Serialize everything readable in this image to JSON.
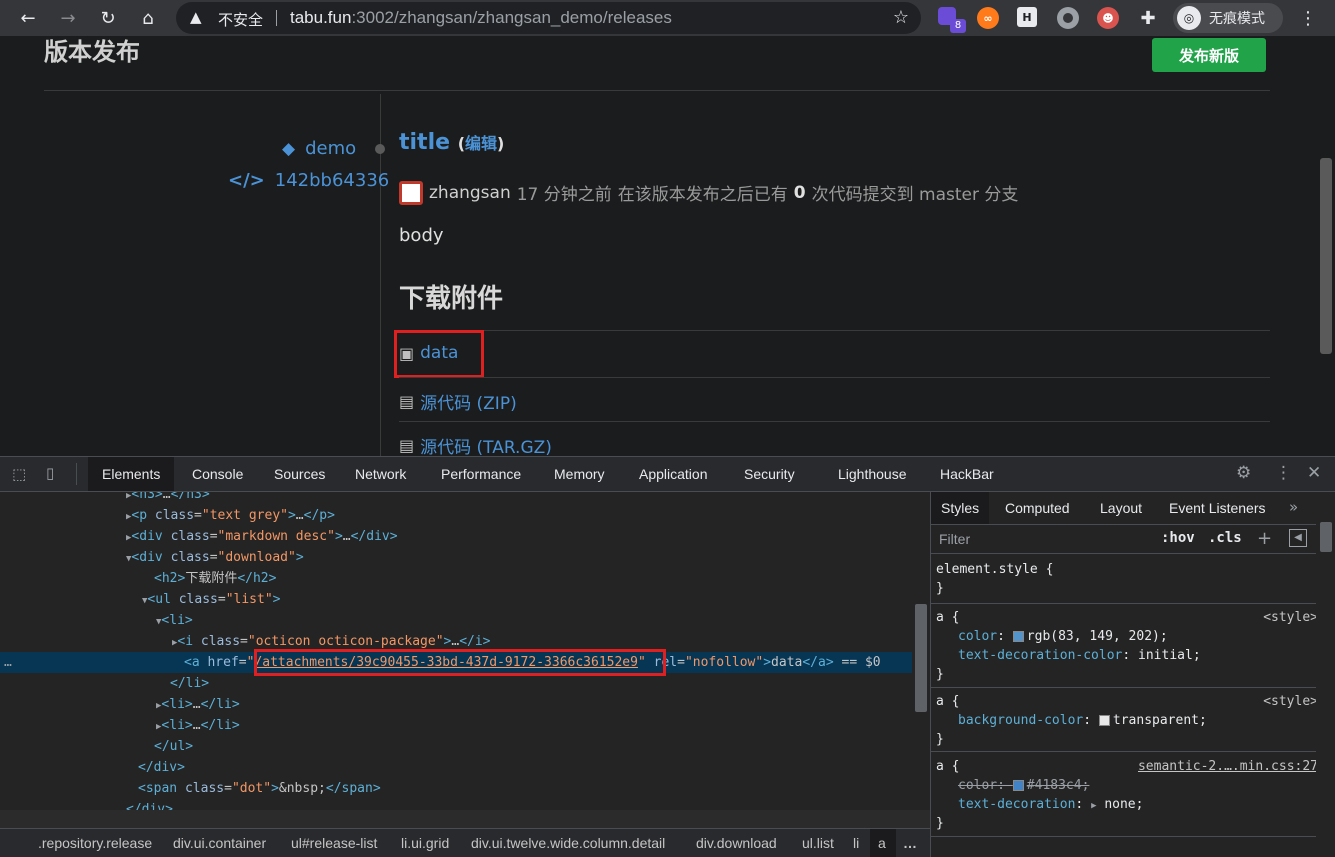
{
  "browser": {
    "insecure_label": "不安全",
    "url_host": "tabu.fun",
    "url_rest": ":3002/zhangsan/zhangsan_demo/releases",
    "incognito_label": "无痕模式",
    "ext_badge": "8"
  },
  "page": {
    "title": "版本发布",
    "publish_button": "发布新版",
    "tag": "demo",
    "commit": "142bb64336",
    "release_title": "title",
    "edit_open": "(",
    "edit_label": "编辑",
    "edit_close": ")",
    "author": "zhangsan",
    "time": "17 分钟之前",
    "commits_prefix": "在该版本发布之后已有",
    "commits_count": "0",
    "commits_suffix": "次代码提交到 master 分支",
    "body": "body",
    "downloads_heading": "下载附件",
    "downloads": [
      {
        "label": "data"
      },
      {
        "label": "源代码 (ZIP)"
      },
      {
        "label": "源代码 (TAR.GZ)"
      }
    ]
  },
  "devtools": {
    "tabs": [
      "Elements",
      "Console",
      "Sources",
      "Network",
      "Performance",
      "Memory",
      "Application",
      "Security",
      "Lighthouse",
      "HackBar"
    ],
    "dom_lines": [
      {
        "t": "▶<h3>…</h3>"
      },
      {
        "t": "▶<p class=\"text grey\">…</p>"
      },
      {
        "t": "▶<div class=\"markdown desc\">…</div>"
      },
      {
        "t": "▼<div class=\"download\">"
      },
      {
        "t": "<h2>下载附件</h2>"
      },
      {
        "t": "▼<ul class=\"list\">"
      },
      {
        "t": "▼<li>"
      },
      {
        "t": "▶<i class=\"octicon octicon-package\">…</i>"
      },
      {
        "t": "<a href=\"/attachments/39c90455-33bd-437d-9172-3366c36152e9\" rel=\"nofollow\">data</a> == $0"
      },
      {
        "t": "</li>"
      },
      {
        "t": "▶<li>…</li>"
      },
      {
        "t": "▶<li>…</li>"
      },
      {
        "t": "</ul>"
      },
      {
        "t": "</div>"
      },
      {
        "t": "<span class=\"dot\">&nbsp;</span>"
      },
      {
        "t": "</div>"
      }
    ],
    "href_value": "/attachments/39c90455-33bd-437d-9172-3366c36152e9",
    "breadcrumbs": [
      ".repository.release",
      "div.ui.container",
      "ul#release-list",
      "li.ui.grid",
      "div.ui.twelve.wide.column.detail",
      "div.download",
      "ul.list",
      "li",
      "a"
    ],
    "styles_tabs": [
      "Styles",
      "Computed",
      "Layout",
      "Event Listeners"
    ],
    "filter_placeholder": "Filter",
    "hov": ":hov",
    "cls": ".cls",
    "rules": {
      "element_style": "element.style {",
      "close": "}",
      "a_open": "a {",
      "src_style": "<style>",
      "src_semantic": "semantic-2.….min.css:27",
      "color_prop": "color",
      "color_val": "rgb(83, 149, 202);",
      "tdc_prop": "text-decoration-color",
      "tdc_val": "initial;",
      "bg_prop": "background-color",
      "bg_val": "transparent;",
      "color2_val": "#4183c4;",
      "td_prop": "text-decoration",
      "td_val": "none;"
    },
    "colors": {
      "link": "#5395ca",
      "semantic_link": "#4183c4"
    }
  }
}
